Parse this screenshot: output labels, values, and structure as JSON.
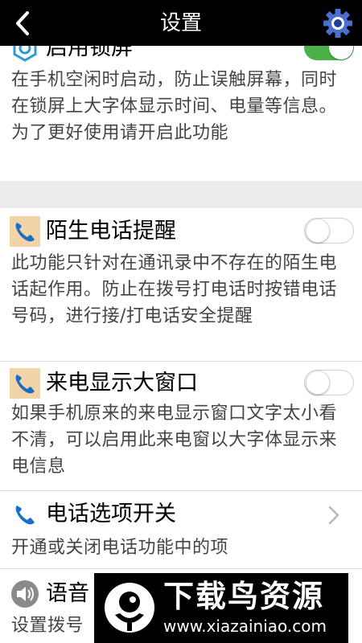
{
  "header": {
    "title": "设置",
    "back_icon": "back-chevron-icon",
    "settings_icon": "gear-icon"
  },
  "settings": [
    {
      "title": "启用锁屏",
      "description": "在手机空闲时启动，防止误触屏幕，同时在锁屏上大字体显示时间、电量等信息。为了更好使用请开启此功能",
      "icon": "lock-screen-gear-icon",
      "control": "toggle",
      "enabled": true
    },
    {
      "title": "陌生电话提醒",
      "description": "此功能只针对在通讯录中不存在的陌生电话起作用。防止在拨号打电话时按错电话号码，进行接/打电话安全提醒",
      "icon": "phone-icon",
      "control": "toggle",
      "enabled": false
    },
    {
      "title": "来电显示大窗口",
      "description": "如果手机原来的来电显示窗口文字太小看不清，可以启用此来电窗以大字体显示来电信息",
      "icon": "phone-icon",
      "control": "toggle",
      "enabled": false
    },
    {
      "title": "电话选项开关",
      "description": "开通或关闭电话功能中的项",
      "icon": "phone-icon",
      "control": "chevron"
    },
    {
      "title": "语音",
      "description": "设置拨号",
      "icon": "speaker-icon"
    }
  ],
  "watermark": {
    "name": "下载鸟资源",
    "url": "www.xiazainiao.com"
  },
  "colors": {
    "header_bg": "#000000",
    "toggle_on": "#4cb04a",
    "icon_blue": "#1a6fc4",
    "icon_bg": "#f3d3a8",
    "section_gap": "#ececec"
  }
}
